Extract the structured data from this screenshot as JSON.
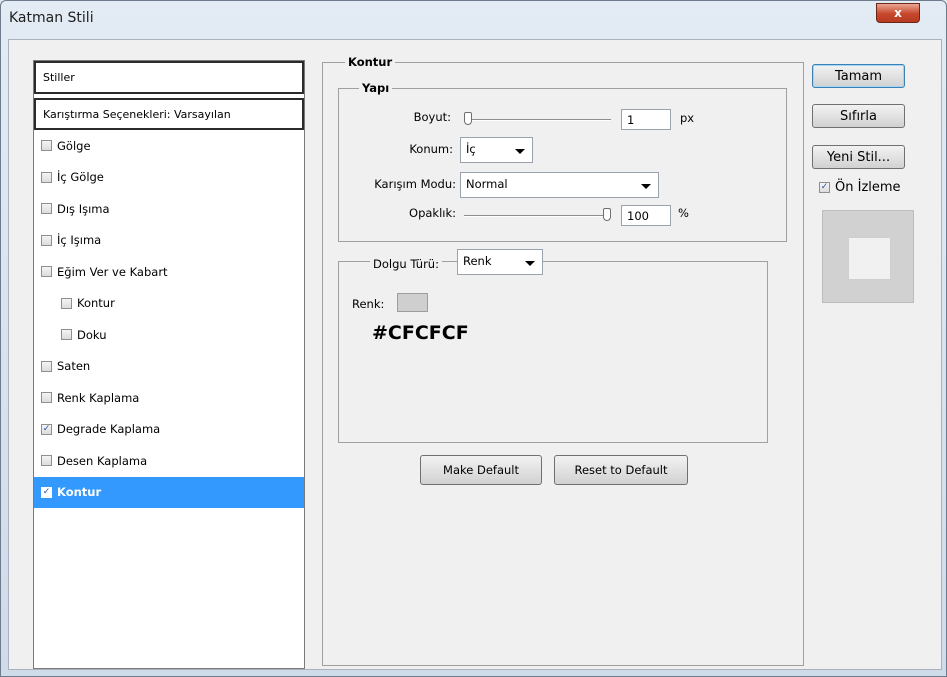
{
  "window": {
    "title": "Katman Stili",
    "close_glyph": "x"
  },
  "styles_panel": {
    "header": "Stiller",
    "blend_options": "Karıştırma Seçenekleri: Varsayılan",
    "items": [
      {
        "label": "Gölge",
        "checked": false
      },
      {
        "label": "İç Gölge",
        "checked": false
      },
      {
        "label": "Dış Işıma",
        "checked": false
      },
      {
        "label": "İç Işıma",
        "checked": false
      },
      {
        "label": "Eğim Ver ve Kabart",
        "checked": false
      },
      {
        "label": "Kontur",
        "checked": false,
        "sub": true
      },
      {
        "label": "Doku",
        "checked": false,
        "sub": true
      },
      {
        "label": "Saten",
        "checked": false
      },
      {
        "label": "Renk Kaplama",
        "checked": false
      },
      {
        "label": "Degrade Kaplama",
        "checked": true
      },
      {
        "label": "Desen Kaplama",
        "checked": false
      },
      {
        "label": "Kontur",
        "checked": true,
        "selected": true
      }
    ]
  },
  "kontur": {
    "section_title": "Kontur",
    "structure_title": "Yapı",
    "size_label": "Boyut:",
    "size_value": "1",
    "size_unit": "px",
    "size_level": 0.0,
    "position_label": "Konum:",
    "position_value": "İç",
    "blend_label": "Karışım Modu:",
    "blend_value": "Normal",
    "opacity_label": "Opaklık:",
    "opacity_value": "100",
    "opacity_unit": "%",
    "opacity_level": 1.0,
    "fill_type_label": "Dolgu Türü:",
    "fill_type_value": "Renk",
    "color_label": "Renk:",
    "color_hex": "#CFCFCF",
    "make_default": "Make Default",
    "reset_default": "Reset to Default"
  },
  "actions": {
    "ok": "Tamam",
    "reset": "Sıfırla",
    "new_style": "Yeni Stil...",
    "preview_label": "Ön İzleme",
    "preview_checked": true
  },
  "colors": {
    "selection": "#3399ff",
    "swatch": "#CFCFCF",
    "close_red": "#c7472b"
  }
}
